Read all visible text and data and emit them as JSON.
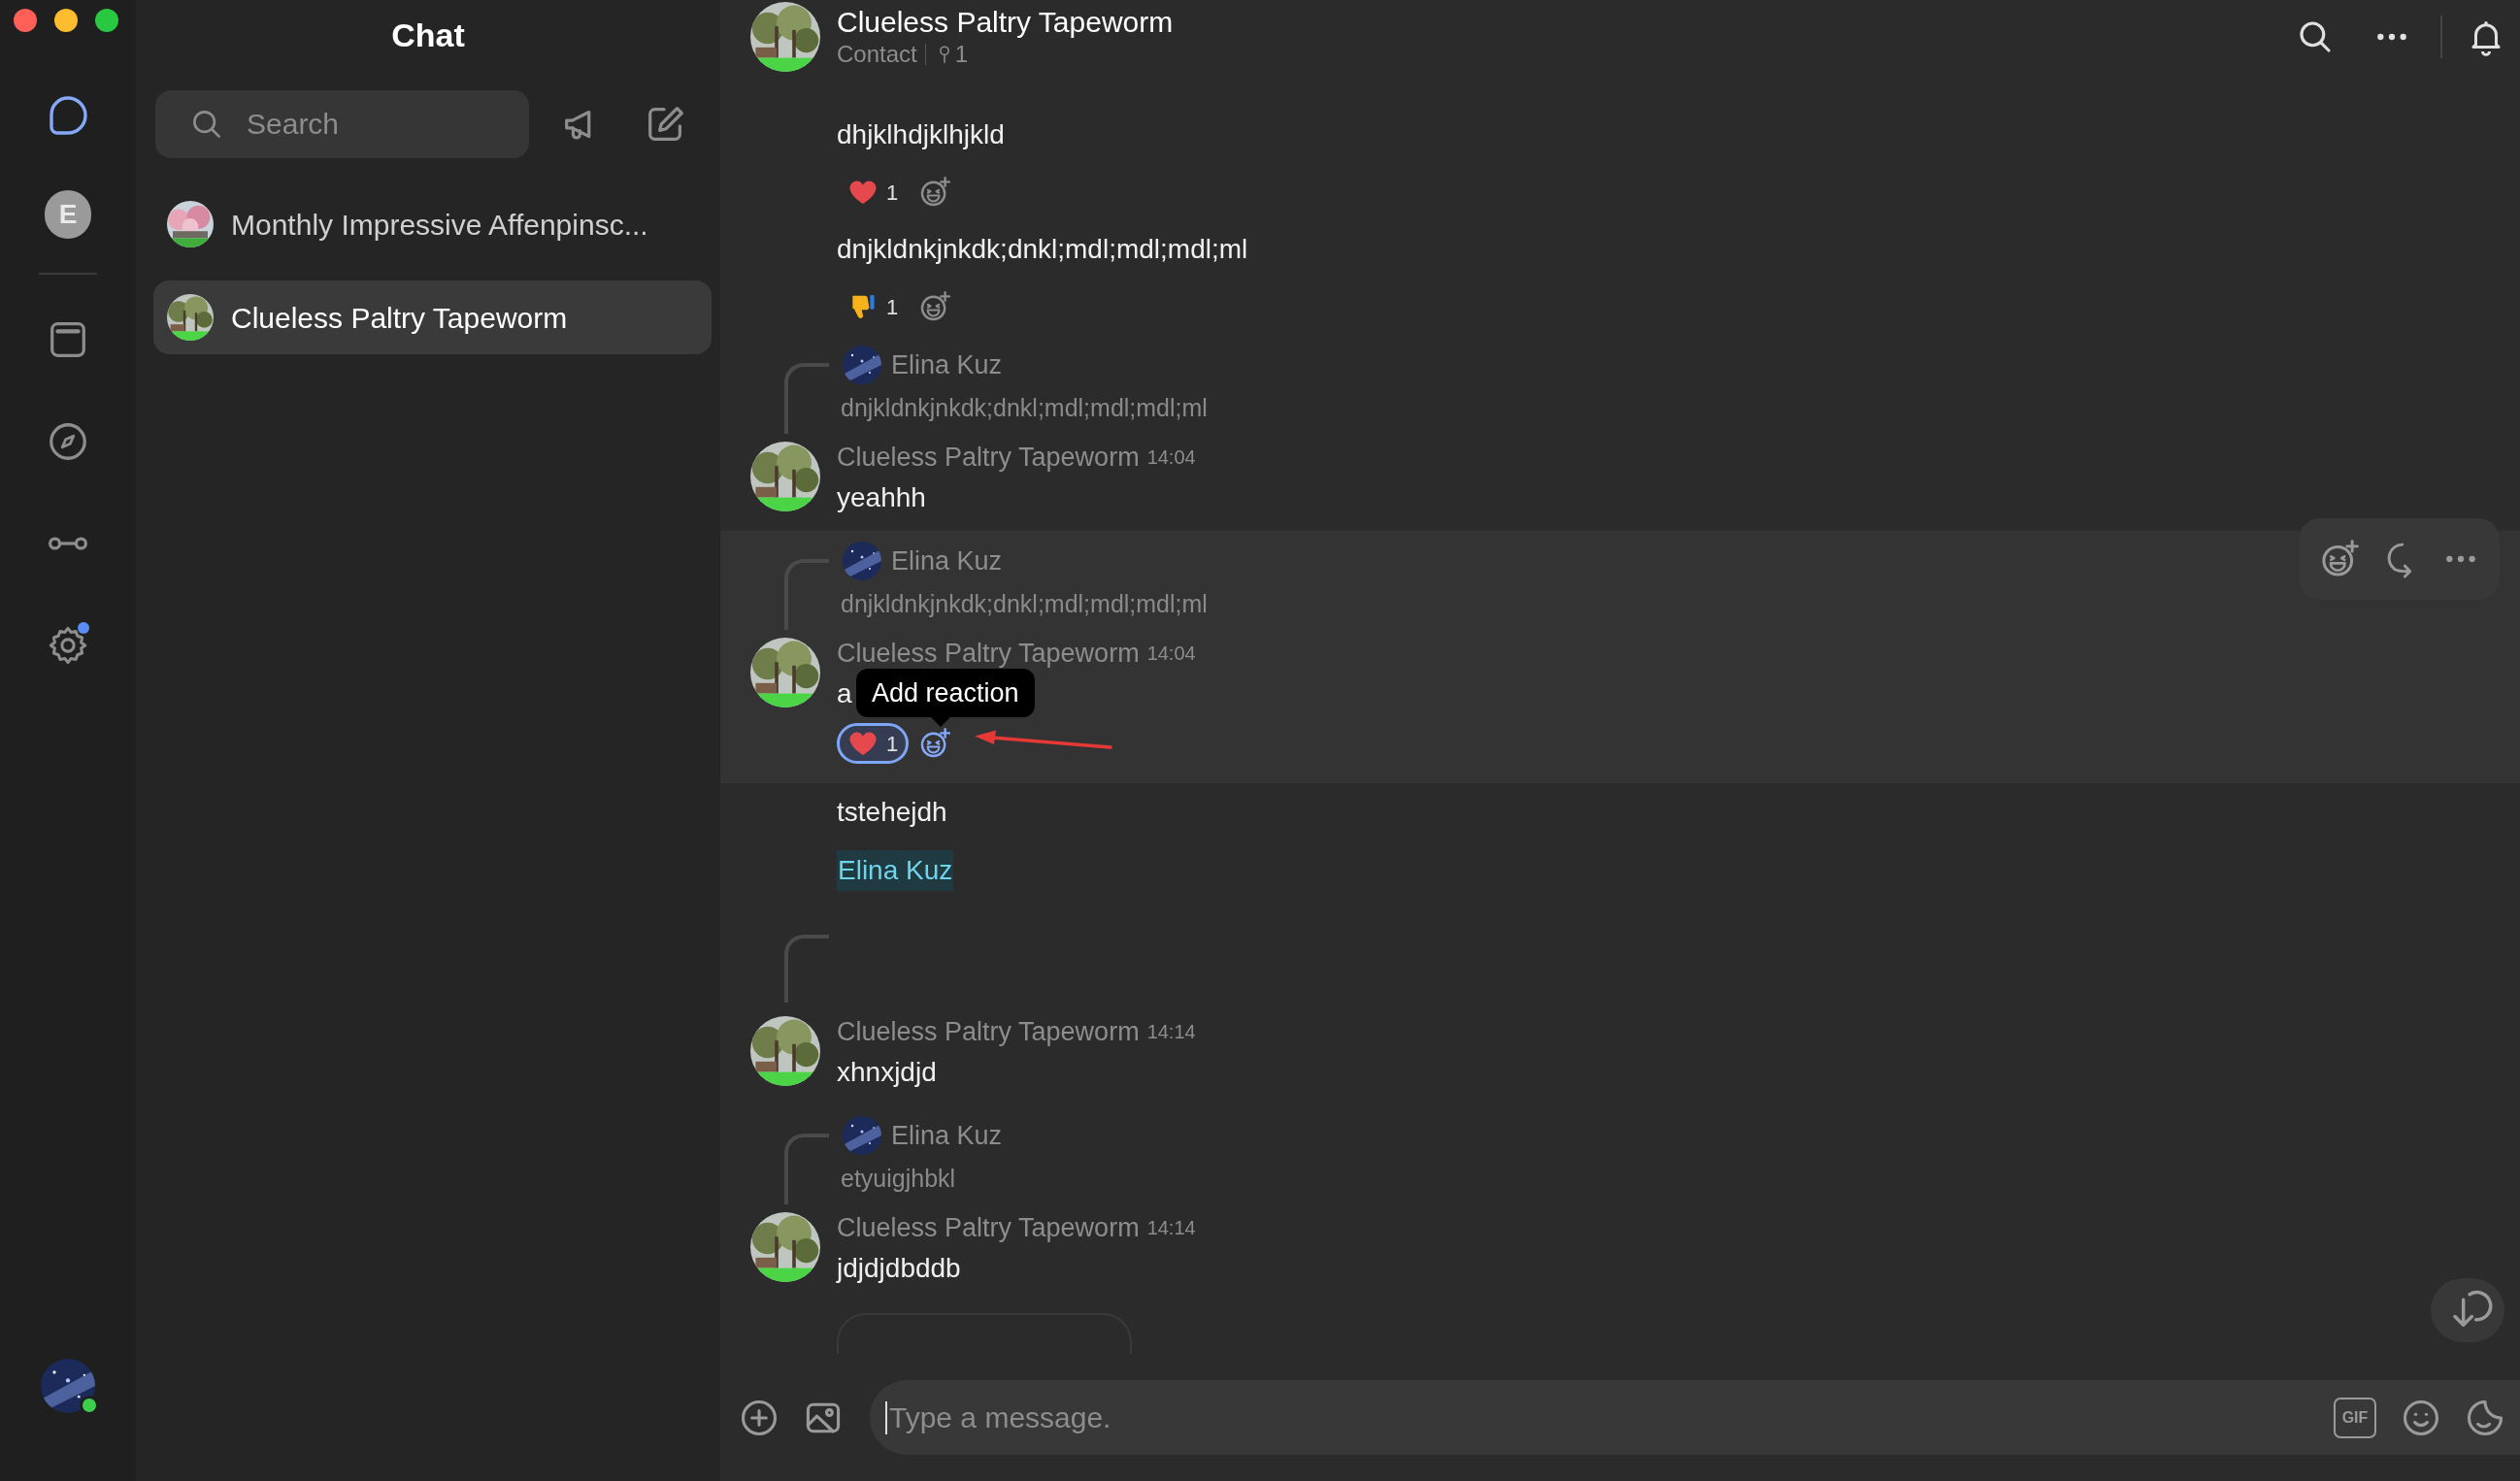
{
  "rail": {
    "top": [
      {
        "kind": "chat",
        "selected": true
      },
      {
        "kind": "avatar",
        "letter": "E",
        "selected": false
      }
    ],
    "apps": [
      {
        "kind": "window",
        "selected": false
      },
      {
        "kind": "compass",
        "selected": false
      },
      {
        "kind": "connector",
        "selected": false
      },
      {
        "kind": "settings",
        "selected": false,
        "badge": true
      }
    ],
    "user": {
      "online": true
    }
  },
  "sidebar": {
    "title": "Chat",
    "search": {
      "placeholder": "Search"
    },
    "chats": [
      {
        "name": "Monthly Impressive Affenpinsc...",
        "selected": false
      },
      {
        "name": "Clueless Paltry Tapeworm",
        "selected": true
      }
    ]
  },
  "conversation": {
    "name": "Clueless Paltry Tapeworm",
    "subtitle": "Contact",
    "pins": "1"
  },
  "messages": [
    {
      "kind": "continuation",
      "text": "dhjklhdjklhjkld",
      "reactions": [
        {
          "kind": "heart",
          "count": "1",
          "mine": false
        }
      ]
    },
    {
      "kind": "continuation",
      "text": "dnjkldnkjnkdk;dnkl;mdl;mdl;mdl;ml",
      "reactions": [
        {
          "kind": "thumbs_down",
          "count": "1",
          "mine": false
        }
      ]
    },
    {
      "kind": "full",
      "reply": {
        "kind": "quote",
        "author": "Elina Kuz",
        "text": "dnjkldnkjnkdk;dnkl;mdl;mdl;mdl;ml"
      },
      "author": "Clueless Paltry Tapeworm",
      "time": "14:04",
      "text": "yeahhh"
    },
    {
      "kind": "full",
      "reply": {
        "kind": "quote",
        "author": "Elina Kuz",
        "text": "dnjkldnkjnkdk;dnkl;mdl;mdl;mdl;ml"
      },
      "author": "Clueless Paltry Tapeworm",
      "time": "14:04",
      "text": "a",
      "hovered": true,
      "tooltip": "Add reaction",
      "pointer_arrow": true,
      "reactions": [
        {
          "kind": "heart",
          "count": "1",
          "mine": true
        }
      ]
    },
    {
      "kind": "continuation",
      "text": "tstehejdh"
    },
    {
      "kind": "mention",
      "text": "Elina Kuz"
    },
    {
      "kind": "full",
      "reply": {
        "kind": "empty"
      },
      "author": "Clueless Paltry Tapeworm",
      "time": "14:14",
      "text": "xhnxjdjd"
    },
    {
      "kind": "full",
      "reply": {
        "kind": "quote",
        "author": "Elina Kuz",
        "text": "etyuigjhbkl"
      },
      "author": "Clueless Paltry Tapeworm",
      "time": "14:14",
      "text": "jdjdjdbddb"
    }
  ],
  "composer": {
    "placeholder": "Type a message.",
    "gif_label": "GIF"
  }
}
